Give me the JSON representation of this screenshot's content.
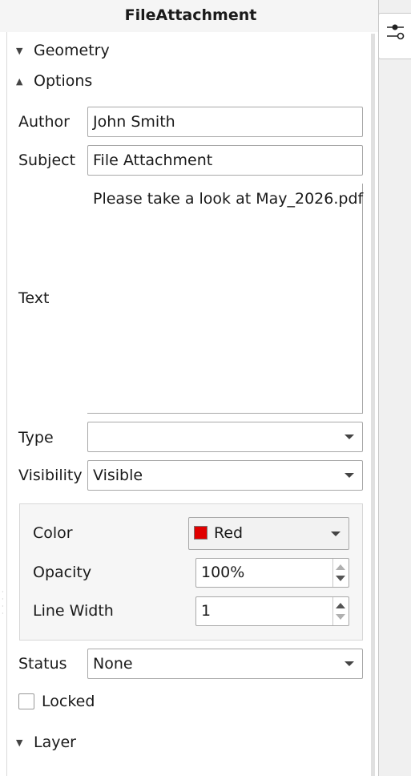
{
  "title": "FileAttachment",
  "sections": {
    "geometry": "Geometry",
    "options": "Options",
    "layer": "Layer"
  },
  "fields": {
    "author_label": "Author",
    "author_value": "John Smith",
    "subject_label": "Subject",
    "subject_value": "File Attachment",
    "text_label": "Text",
    "text_value": "Please take a look at May_2026.pdf",
    "type_label": "Type",
    "type_value": "",
    "visibility_label": "Visibility",
    "visibility_value": "Visible",
    "status_label": "Status",
    "status_value": "None",
    "locked_label": "Locked",
    "locked_checked": false
  },
  "appearance": {
    "color_label": "Color",
    "color_value": "Red",
    "color_swatch": "#e00000",
    "opacity_label": "Opacity",
    "opacity_value": "100%",
    "line_width_label": "Line Width",
    "line_width_value": "1"
  },
  "icons": {
    "sidebar_tab": "properties-sliders-icon"
  }
}
